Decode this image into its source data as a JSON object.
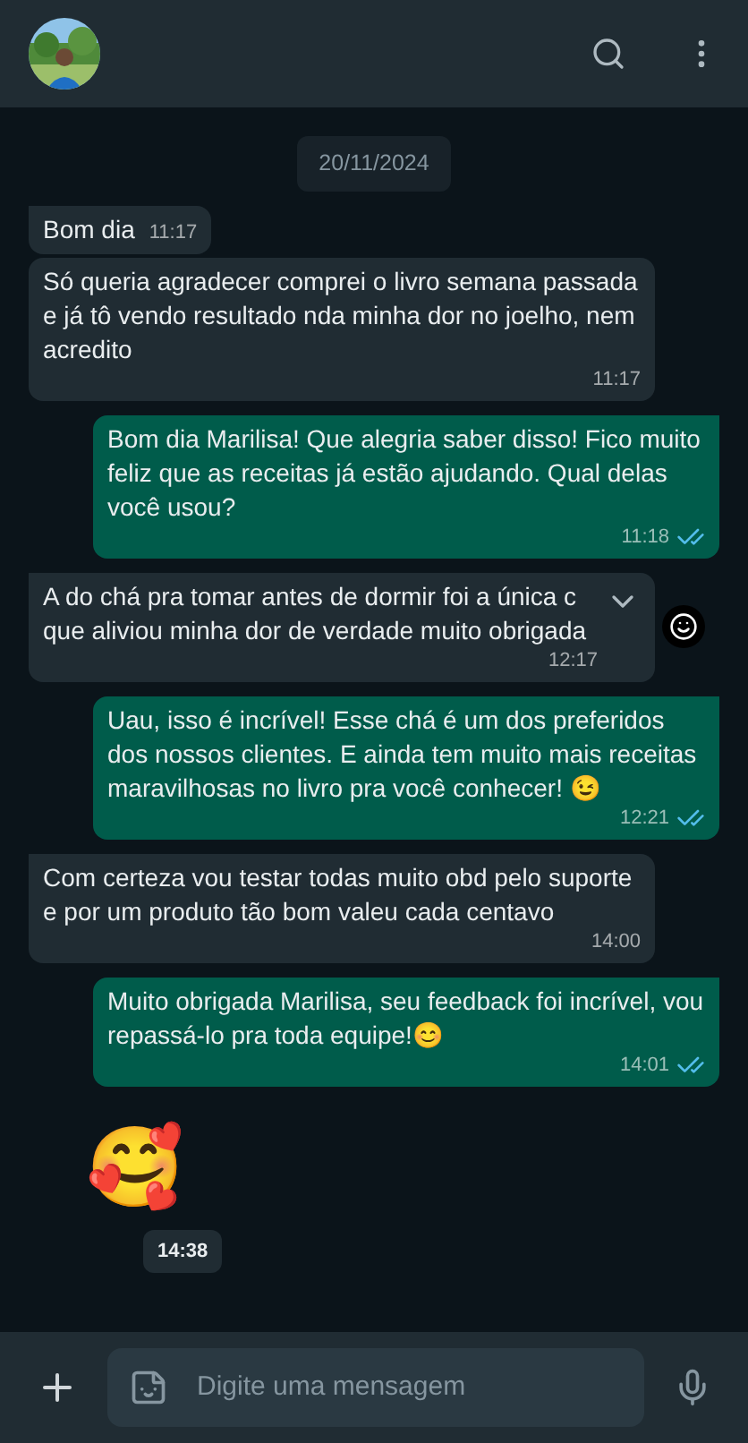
{
  "date": "20/11/2024",
  "messages": [
    {
      "kind": "incoming",
      "text": "Bom dia",
      "time": "11:17",
      "tail": true,
      "hovered": false
    },
    {
      "kind": "incoming",
      "text": "Só queria agradecer comprei o livro semana passada e já tô vendo resultado nda minha dor no joelho, nem acredito",
      "time": "11:17",
      "tail": false,
      "hovered": false
    },
    {
      "kind": "outgoing",
      "text": "Bom dia Marilisa! Que alegria saber disso! Fico muito feliz que as receitas já estão ajudando. Qual delas você usou?",
      "time": "11:18",
      "tail": true,
      "read": true
    },
    {
      "kind": "incoming",
      "text": "A do chá pra tomar antes de dormir foi a única c que aliviou minha dor de verdade muito obrigada",
      "time": "12:17",
      "tail": true,
      "hovered": true
    },
    {
      "kind": "outgoing",
      "text": "Uau, isso é incrível! Esse chá é um dos preferidos dos nossos clientes. E ainda tem muito mais receitas maravilhosas no livro pra você conhecer! 😉",
      "time": "12:21",
      "tail": true,
      "read": true
    },
    {
      "kind": "incoming",
      "text": "Com certeza vou testar todas muito obd pelo suporte e por um produto tão bom valeu cada centavo",
      "time": "14:00",
      "tail": true,
      "hovered": false
    },
    {
      "kind": "outgoing",
      "text": "Muito obrigada Marilisa, seu feedback foi incrível, vou repassá-lo pra toda equipe!😊",
      "time": "14:01",
      "tail": true,
      "read": true
    },
    {
      "kind": "emoji",
      "text": "🥰",
      "time": "14:38"
    }
  ],
  "composer": {
    "placeholder": "Digite uma mensagem"
  }
}
